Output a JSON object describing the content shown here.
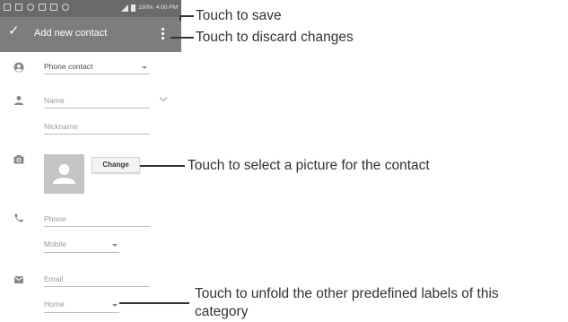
{
  "status_bar": {
    "battery": "100%",
    "time": "4:00 PM"
  },
  "app_bar": {
    "title": "Add new contact"
  },
  "form": {
    "account": "Phone contact",
    "name_placeholder": "Name",
    "nickname_placeholder": "Nickname",
    "photo_button": "Change",
    "phone_placeholder": "Phone",
    "phone_type": "Mobile",
    "email_placeholder": "Email",
    "email_type": "Home"
  },
  "callouts": {
    "save": "Touch to save",
    "discard": "Touch to discard changes",
    "picture": "Touch to select a picture for the contact",
    "labels_line1": "Touch to unfold the other predefined labels of this",
    "labels_line2": "category"
  },
  "colors": {
    "app_bar": "#7d7d7d",
    "status_bar": "#6a6a6a",
    "icon": "#8a8a8a",
    "avatar": "#c4c4c4"
  },
  "icons": {
    "save": "check-icon",
    "menu": "more-vert-icon",
    "account": "account-circle-icon",
    "name": "person-icon",
    "photo": "camera-icon",
    "phone": "phone-icon",
    "email": "mail-icon"
  }
}
